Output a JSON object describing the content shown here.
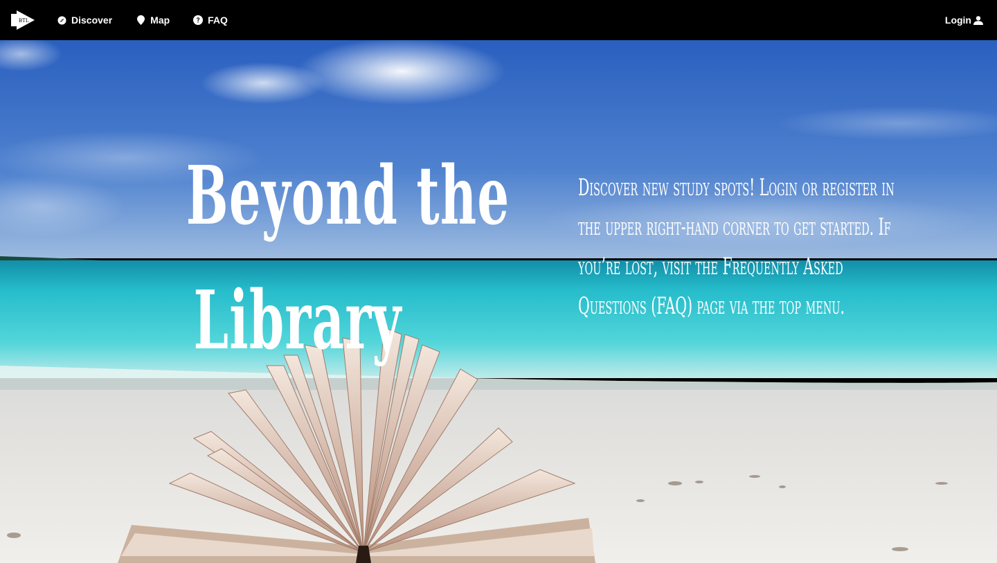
{
  "nav": {
    "logo_text": "BTL",
    "items": [
      {
        "label": "Discover",
        "icon": "compass-icon"
      },
      {
        "label": "Map",
        "icon": "map-marker-icon"
      },
      {
        "label": "FAQ",
        "icon": "question-circle-icon"
      }
    ],
    "login_label": "Login",
    "login_icon": "user-icon"
  },
  "hero": {
    "title_line1": "Beyond the",
    "title_line2": "Library",
    "description_lines": [
      "Discover new study spots! Login or register in",
      "the upper right-hand corner to get started. If",
      "you’re lost, visit the Frequently Asked",
      "Questions (FAQ) page via the top menu."
    ]
  },
  "colors": {
    "navbar_bg": "#000000",
    "text": "#ffffff",
    "sky": "#3a6fc4",
    "sea": "#2fc6d2",
    "sand": "#eceae6"
  }
}
